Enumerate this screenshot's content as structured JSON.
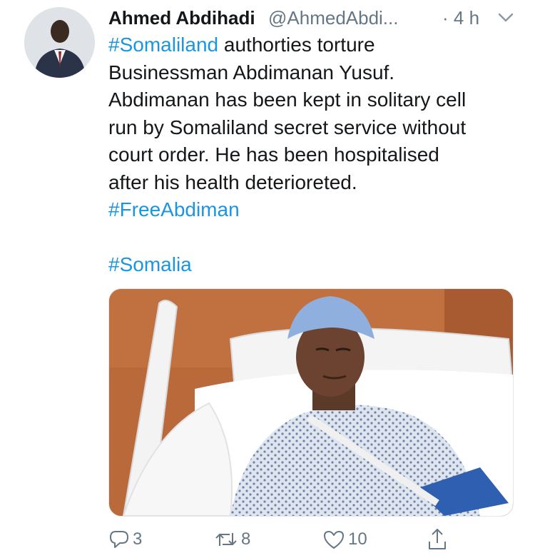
{
  "tweet": {
    "author_name": "Ahmed Abdihadi",
    "author_handle": "@AhmedAbdi...",
    "timestamp": "· 4 h",
    "lines": [
      {
        "tag": "#Somaliland",
        "text": " authorties torture"
      },
      {
        "text": "Businessman Abdimanan Yusuf."
      },
      {
        "text": "Abdimanan has been kept in solitary cell"
      },
      {
        "text": "run by Somaliland secret service without"
      },
      {
        "text": "court order. He has been hospitalised"
      },
      {
        "text": "after his health deterioreted."
      }
    ],
    "hashtag_1": "#FreeAbdiman",
    "hashtag_2": "#Somalia"
  },
  "actions": {
    "reply_count": "3",
    "retweet_count": "8",
    "like_count": "10"
  },
  "colors": {
    "link": "#1b95e0",
    "secondary_text": "#657786",
    "primary_text": "#14171a"
  },
  "icons": [
    "reply-icon",
    "retweet-icon",
    "like-icon",
    "share-icon",
    "chevron-down-icon"
  ]
}
